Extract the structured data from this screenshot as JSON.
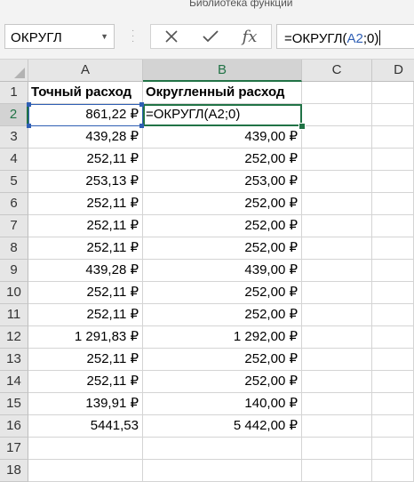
{
  "ribbon": {
    "group_label": "Библиотека функций"
  },
  "formula_bar": {
    "name_box": "ОКРУГЛ",
    "formula_prefix": "=ОКРУГЛ(",
    "formula_ref": "A2",
    "formula_suffix": ";0)",
    "icons": [
      "cancel-icon",
      "enter-icon",
      "insert-function-icon"
    ],
    "fx_label": "fx"
  },
  "sheet": {
    "columns": [
      "A",
      "B",
      "C",
      "D"
    ],
    "selected_column": "B",
    "selected_row": "2",
    "rows": [
      {
        "n": "1",
        "a": "Точный расход",
        "b": "Округленный расход"
      },
      {
        "n": "2",
        "a": "861,22 ₽",
        "b": "=ОКРУГЛ(A2;0)"
      },
      {
        "n": "3",
        "a": "439,28 ₽",
        "b": "439,00 ₽"
      },
      {
        "n": "4",
        "a": "252,11 ₽",
        "b": "252,00 ₽"
      },
      {
        "n": "5",
        "a": "253,13 ₽",
        "b": "253,00 ₽"
      },
      {
        "n": "6",
        "a": "252,11 ₽",
        "b": "252,00 ₽"
      },
      {
        "n": "7",
        "a": "252,11 ₽",
        "b": "252,00 ₽"
      },
      {
        "n": "8",
        "a": "252,11 ₽",
        "b": "252,00 ₽"
      },
      {
        "n": "9",
        "a": "439,28 ₽",
        "b": "439,00 ₽"
      },
      {
        "n": "10",
        "a": "252,11 ₽",
        "b": "252,00 ₽"
      },
      {
        "n": "11",
        "a": "252,11 ₽",
        "b": "252,00 ₽"
      },
      {
        "n": "12",
        "a": "1 291,83 ₽",
        "b": "1 292,00 ₽"
      },
      {
        "n": "13",
        "a": "252,11 ₽",
        "b": "252,00 ₽"
      },
      {
        "n": "14",
        "a": "252,11 ₽",
        "b": "252,00 ₽"
      },
      {
        "n": "15",
        "a": "139,91 ₽",
        "b": "140,00 ₽"
      },
      {
        "n": "16",
        "a": "5441,53",
        "b": "5 442,00 ₽"
      },
      {
        "n": "17",
        "a": "",
        "b": ""
      },
      {
        "n": "18",
        "a": "",
        "b": ""
      }
    ]
  },
  "colors": {
    "accent_green": "#217346",
    "ref_blue": "#2f5fb4",
    "header_bg": "#e6e6e6"
  }
}
